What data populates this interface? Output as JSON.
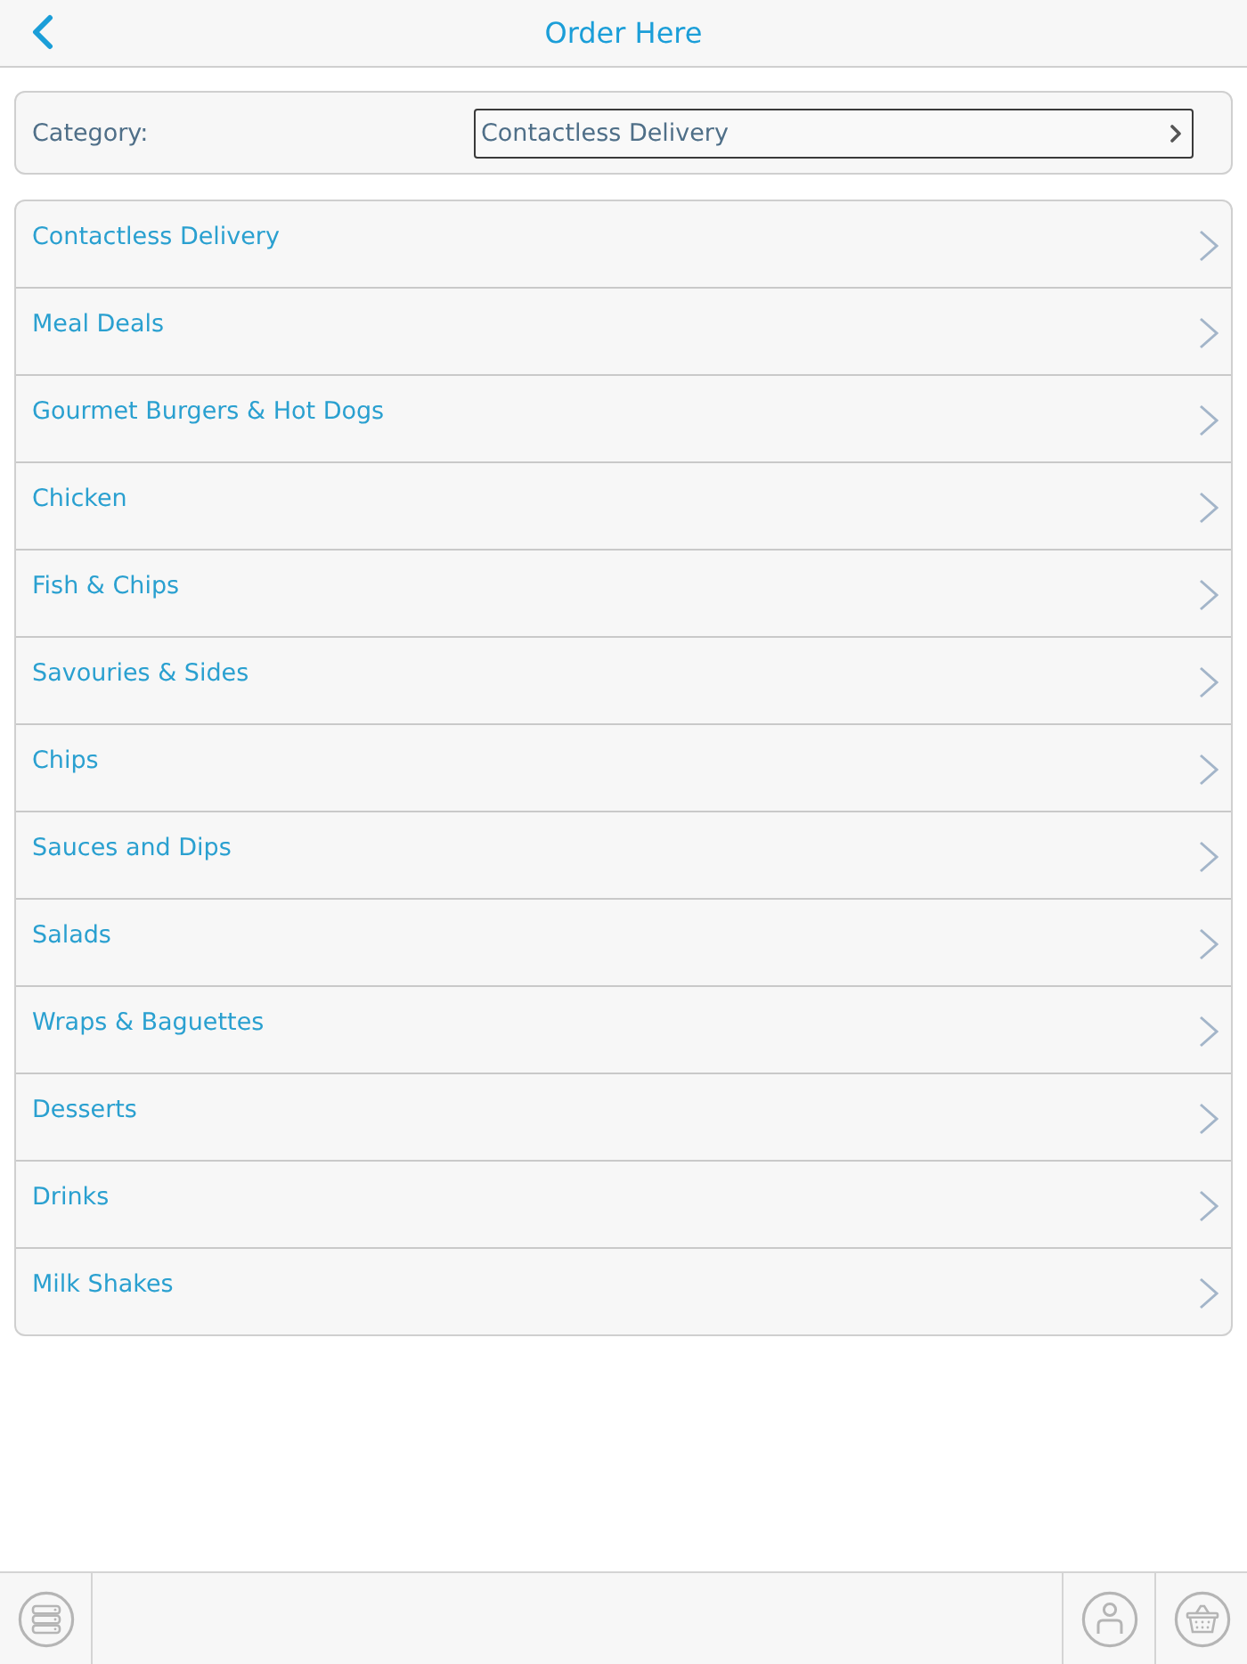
{
  "header": {
    "title": "Order Here"
  },
  "category_filter": {
    "label": "Category:",
    "value": "Contactless Delivery"
  },
  "categories": [
    {
      "label": "Contactless Delivery"
    },
    {
      "label": "Meal Deals"
    },
    {
      "label": "Gourmet Burgers & Hot Dogs"
    },
    {
      "label": "Chicken"
    },
    {
      "label": "Fish & Chips"
    },
    {
      "label": "Savouries & Sides"
    },
    {
      "label": "Chips"
    },
    {
      "label": "Sauces and Dips"
    },
    {
      "label": "Salads"
    },
    {
      "label": "Wraps & Baguettes"
    },
    {
      "label": "Desserts"
    },
    {
      "label": "Drinks"
    },
    {
      "label": "Milk Shakes"
    }
  ]
}
